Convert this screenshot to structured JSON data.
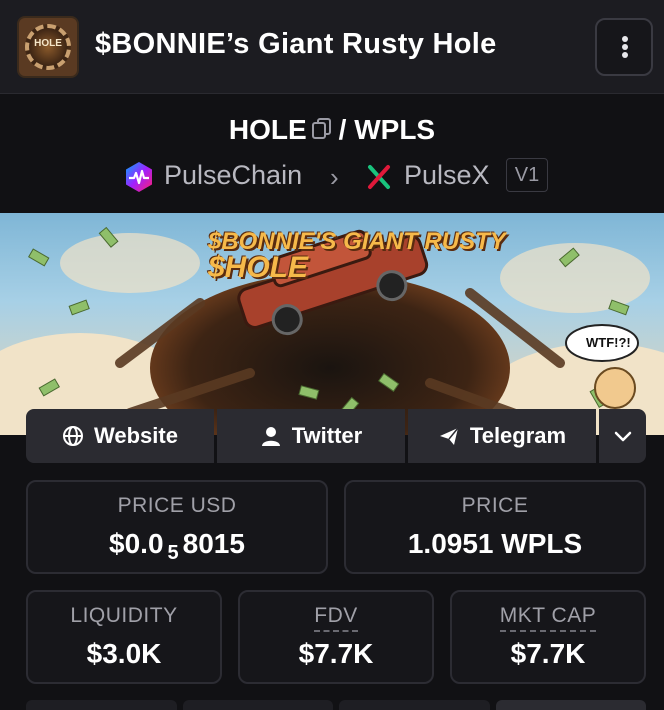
{
  "header": {
    "title": "$BONNIE’s Giant Rusty Hole",
    "logo_text": "HOLE",
    "menu_icon": "more-vertical-icon"
  },
  "pair": {
    "base": "HOLE",
    "separator": "/",
    "quote": "WPLS"
  },
  "chain": {
    "name": "PulseChain",
    "dex": "PulseX",
    "version": "V1"
  },
  "banner": {
    "line1": "$BONNIE'S GIANT RUSTY",
    "line2": "$HOLE",
    "bubble": "WTF!?!"
  },
  "social": {
    "website": "Website",
    "twitter": "Twitter",
    "telegram": "Telegram"
  },
  "stats": {
    "price_usd_label": "PRICE USD",
    "price_usd_prefix": "$0.0",
    "price_usd_sub": "5",
    "price_usd_suffix": "8015",
    "price_label": "PRICE",
    "price_value": "1.0951 WPLS",
    "liquidity_label": "LIQUIDITY",
    "liquidity_value": "$3.0K",
    "fdv_label": "FDV",
    "fdv_value": "$7.7K",
    "mktcap_label": "MKT CAP",
    "mktcap_value": "$7.7K"
  },
  "colors": {
    "background": "#111114",
    "header": "#1c1c21",
    "card_border": "#2c2c33",
    "pulsex_icon": "#e0193a"
  }
}
